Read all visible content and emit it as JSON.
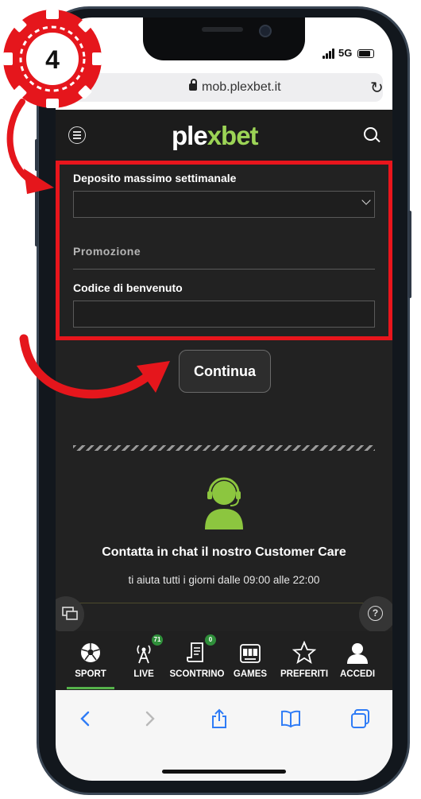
{
  "step": {
    "number": "4"
  },
  "browser": {
    "url": "mob.plexbet.it",
    "reload_icon": "reload-icon"
  },
  "status": {
    "network": "5G"
  },
  "site": {
    "logo_prefix": "ple",
    "logo_x": "x",
    "logo_suffix": "bet"
  },
  "form": {
    "deposit_label": "Deposito massimo settimanale",
    "deposit_value": "",
    "promo_label": "Promozione",
    "code_label": "Codice di benvenuto",
    "code_value": ""
  },
  "continue_label": "Continua",
  "support": {
    "title": "Contatta in chat il nostro Customer Care",
    "subtitle": "ti aiuta tutti i giorni dalle 09:00 alle 22:00"
  },
  "tabs": [
    {
      "label": "SPORT",
      "icon": "soccer-ball-icon",
      "active": true
    },
    {
      "label": "LIVE",
      "icon": "antenna-icon",
      "badge": "71"
    },
    {
      "label": "SCONTRINO",
      "icon": "receipt-icon",
      "badge": "0"
    },
    {
      "label": "GAMES",
      "icon": "slot-machine-icon"
    },
    {
      "label": "PREFERITI",
      "icon": "star-icon"
    },
    {
      "label": "ACCEDI",
      "icon": "user-icon"
    }
  ],
  "colors": {
    "brand_green": "#9cd456",
    "highlight_red": "#e8151c",
    "badge_green": "#2f8f3a"
  }
}
